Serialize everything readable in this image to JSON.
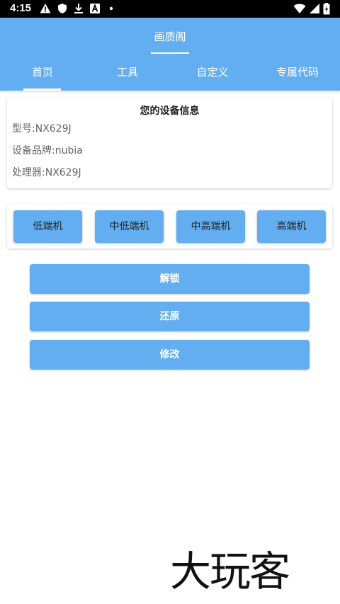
{
  "status_bar": {
    "time": "4:15",
    "icons": [
      "alert-icon",
      "shield-icon",
      "download-icon",
      "a-box-icon",
      "dot-icon",
      "wifi-icon",
      "signal-icon",
      "battery-icon"
    ]
  },
  "app_bar": {
    "title": "画质阁"
  },
  "tabs": [
    {
      "label": "首页",
      "selected": true
    },
    {
      "label": "工具",
      "selected": false
    },
    {
      "label": "自定义",
      "selected": false
    },
    {
      "label": "专属代码",
      "selected": false
    }
  ],
  "device_info": {
    "title": "您的设备信息",
    "model": "型号:NX629J",
    "brand": "设备品牌:nubia",
    "processor": "处理器:NX629J"
  },
  "tiers": [
    "低端机",
    "中低端机",
    "中高端机",
    "高端机"
  ],
  "actions": {
    "unlock": "解锁",
    "restore": "还原",
    "modify": "修改"
  },
  "watermark": "大玩客",
  "colors": {
    "accent": "#63aef0",
    "status_bar": "#000000"
  }
}
